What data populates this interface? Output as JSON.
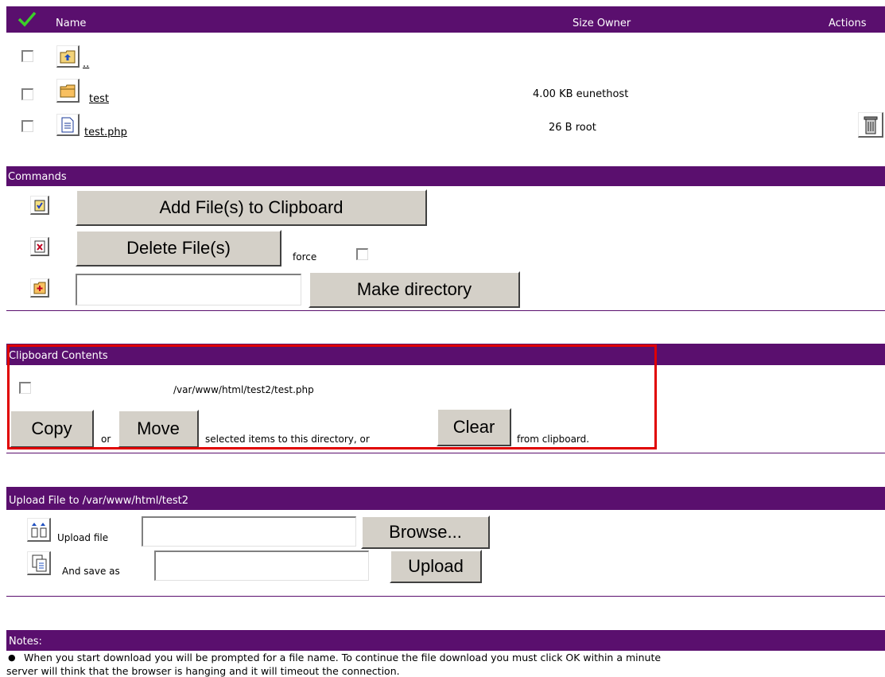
{
  "header": {
    "name": "Name",
    "size_owner": "Size Owner",
    "actions": "Actions",
    "check_icon": "check-icon"
  },
  "files": [
    {
      "name": "..",
      "size_owner": "",
      "icon": "folder-up-icon"
    },
    {
      "name": "test",
      "size_owner": "4.00 KB eunethost",
      "icon": "folder-icon"
    },
    {
      "name": "test.php",
      "size_owner": "26 B root",
      "icon": "file-icon"
    }
  ],
  "commands": {
    "title": "Commands",
    "add_clipboard": "Add File(s) to Clipboard",
    "delete": "Delete File(s)",
    "force": "force",
    "mkdir_value": "",
    "mkdir": "Make directory"
  },
  "clipboard": {
    "title": "Clipboard Contents",
    "item_path": "/var/www/html/test2/test.php",
    "copy": "Copy",
    "or": "or",
    "move": "Move",
    "text1": "selected items to this directory, or",
    "clear": "Clear",
    "text2": "from clipboard."
  },
  "upload": {
    "title": "Upload File to /var/www/html/test2",
    "upload_label": "Upload file",
    "upload_value": "",
    "browse": "Browse...",
    "saveas_label": "And save as",
    "saveas_value": "",
    "upload_btn": "Upload"
  },
  "notes": {
    "title": "Notes:",
    "bullet": "●",
    "line1": "When you start download you will be prompted for a file name. To continue the file download you must click OK within a minute",
    "line2": "server will think that the browser is hanging and it will timeout the connection."
  },
  "colors": {
    "header_bg": "#5a0f6e",
    "highlight": "#e00000"
  }
}
